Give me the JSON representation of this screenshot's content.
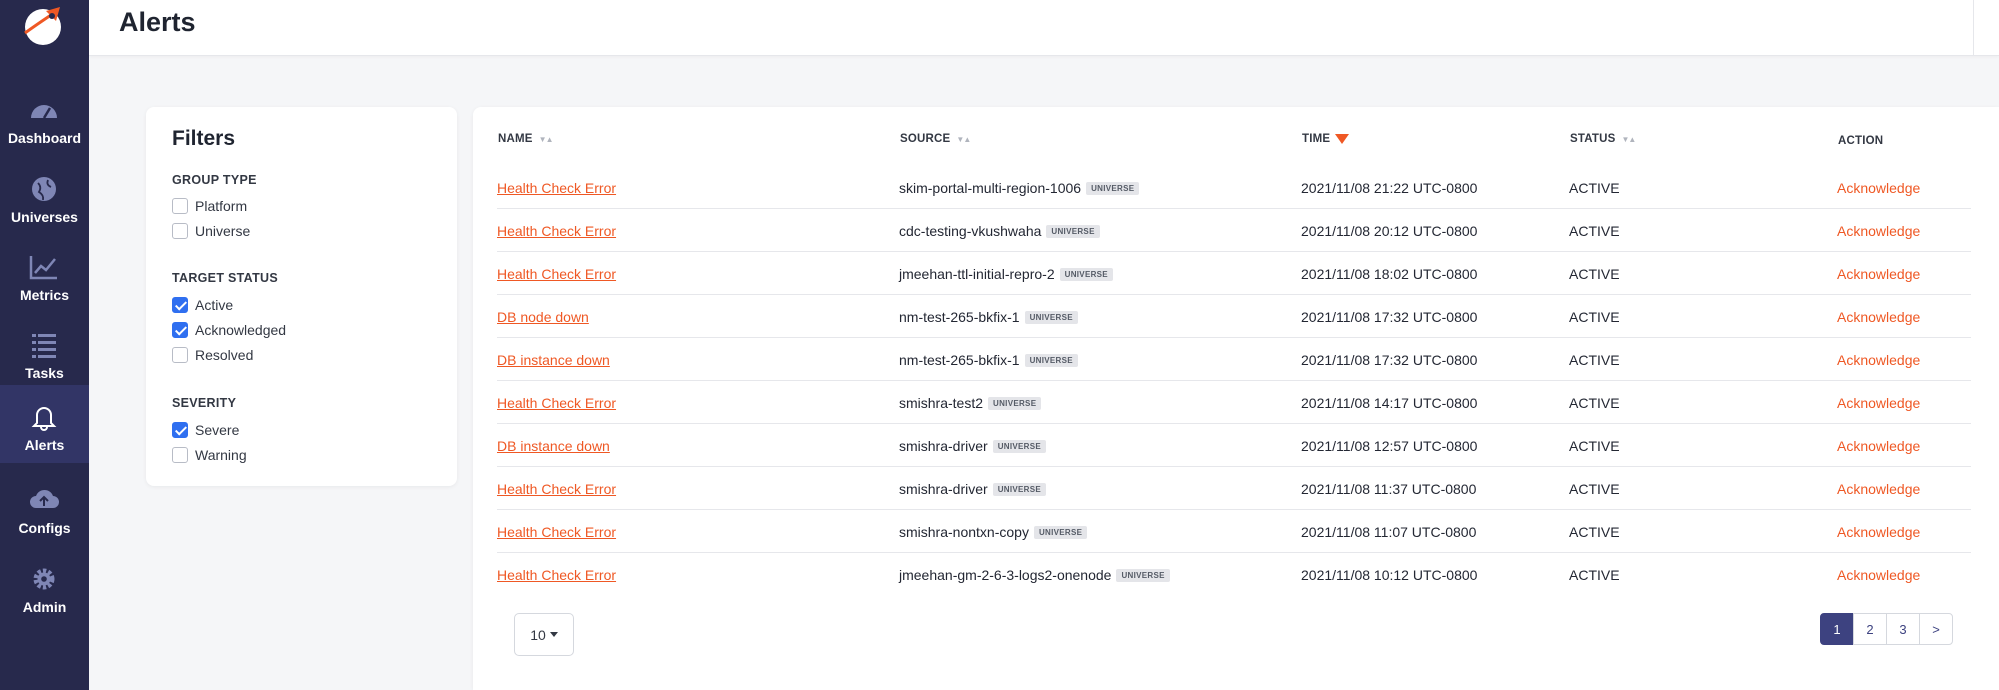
{
  "sidebar": {
    "items": [
      {
        "label": "Dashboard",
        "icon": "dashboard-gauge-icon"
      },
      {
        "label": "Universes",
        "icon": "globe-icon"
      },
      {
        "label": "Metrics",
        "icon": "line-chart-icon"
      },
      {
        "label": "Tasks",
        "icon": "list-icon"
      },
      {
        "label": "Alerts",
        "icon": "bell-icon",
        "active": true
      },
      {
        "label": "Configs",
        "icon": "cloud-upload-icon"
      },
      {
        "label": "Admin",
        "icon": "gear-icon"
      }
    ]
  },
  "header": {
    "title": "Alerts"
  },
  "filters": {
    "title": "Filters",
    "groups": [
      {
        "title": "GROUP TYPE",
        "options": [
          {
            "label": "Platform",
            "checked": false
          },
          {
            "label": "Universe",
            "checked": false
          }
        ]
      },
      {
        "title": "TARGET STATUS",
        "options": [
          {
            "label": "Active",
            "checked": true
          },
          {
            "label": "Acknowledged",
            "checked": true
          },
          {
            "label": "Resolved",
            "checked": false
          }
        ]
      },
      {
        "title": "SEVERITY",
        "options": [
          {
            "label": "Severe",
            "checked": true
          },
          {
            "label": "Warning",
            "checked": false
          }
        ]
      }
    ]
  },
  "table": {
    "columns": {
      "name": "NAME",
      "source": "SOURCE",
      "time": "TIME",
      "status": "STATUS",
      "action": "ACTION"
    },
    "rows": [
      {
        "name": "Health Check Error",
        "source": "skim-portal-multi-region-1006",
        "badge": "UNIVERSE",
        "time": "2021/11/08 21:22 UTC-0800",
        "status": "ACTIVE",
        "action": "Acknowledge"
      },
      {
        "name": "Health Check Error",
        "source": "cdc-testing-vkushwaha",
        "badge": "UNIVERSE",
        "time": "2021/11/08 20:12 UTC-0800",
        "status": "ACTIVE",
        "action": "Acknowledge"
      },
      {
        "name": "Health Check Error",
        "source": "jmeehan-ttl-initial-repro-2",
        "badge": "UNIVERSE",
        "time": "2021/11/08 18:02 UTC-0800",
        "status": "ACTIVE",
        "action": "Acknowledge"
      },
      {
        "name": "DB node down",
        "source": "nm-test-265-bkfix-1",
        "badge": "UNIVERSE",
        "time": "2021/11/08 17:32 UTC-0800",
        "status": "ACTIVE",
        "action": "Acknowledge"
      },
      {
        "name": "DB instance down",
        "source": "nm-test-265-bkfix-1",
        "badge": "UNIVERSE",
        "time": "2021/11/08 17:32 UTC-0800",
        "status": "ACTIVE",
        "action": "Acknowledge"
      },
      {
        "name": "Health Check Error",
        "source": "smishra-test2",
        "badge": "UNIVERSE",
        "time": "2021/11/08 14:17 UTC-0800",
        "status": "ACTIVE",
        "action": "Acknowledge"
      },
      {
        "name": "DB instance down",
        "source": "smishra-driver",
        "badge": "UNIVERSE",
        "time": "2021/11/08 12:57 UTC-0800",
        "status": "ACTIVE",
        "action": "Acknowledge"
      },
      {
        "name": "Health Check Error",
        "source": "smishra-driver",
        "badge": "UNIVERSE",
        "time": "2021/11/08 11:37 UTC-0800",
        "status": "ACTIVE",
        "action": "Acknowledge"
      },
      {
        "name": "Health Check Error",
        "source": "smishra-nontxn-copy",
        "badge": "UNIVERSE",
        "time": "2021/11/08 11:07 UTC-0800",
        "status": "ACTIVE",
        "action": "Acknowledge"
      },
      {
        "name": "Health Check Error",
        "source": "jmeehan-gm-2-6-3-logs2-onenode",
        "badge": "UNIVERSE",
        "time": "2021/11/08 10:12 UTC-0800",
        "status": "ACTIVE",
        "action": "Acknowledge"
      }
    ]
  },
  "pager": {
    "page_size": "10",
    "pages": [
      "1",
      "2",
      "3"
    ],
    "current_page": "1",
    "next_label": ">"
  },
  "colors": {
    "sidebar_bg": "#27294c",
    "accent_orange": "#ef5824",
    "checkbox_blue": "#2f6ff0",
    "pager_active": "#3d4280"
  }
}
